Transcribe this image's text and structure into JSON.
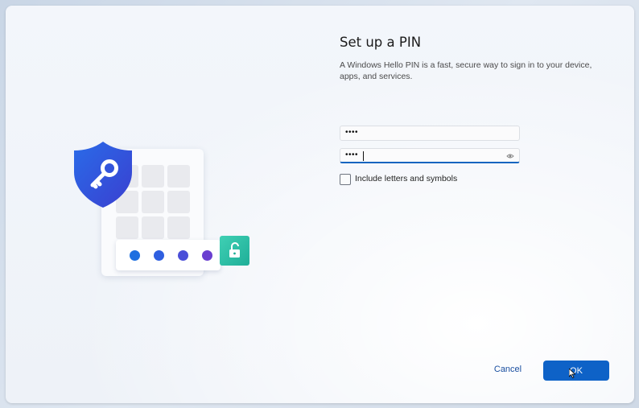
{
  "title": "Set up a PIN",
  "description": "A Windows Hello PIN is a fast, secure way to sign in to your device, apps, and services.",
  "pin_field": {
    "value": "••••"
  },
  "confirm_field": {
    "value": "••••"
  },
  "checkbox": {
    "label": "Include letters and symbols",
    "checked": false
  },
  "buttons": {
    "cancel": "Cancel",
    "ok": "OK"
  },
  "colors": {
    "accent": "#0e62c7",
    "shield": "#2f57e0",
    "lock_tile": "#2bbfa6",
    "dots": [
      "#1e6fe0",
      "#2f5fe0",
      "#4b4fd8",
      "#6a3fd0"
    ]
  },
  "icons": {
    "shield": "key-shield-icon",
    "lock": "unlocked-padlock-icon",
    "reveal": "eye-icon"
  }
}
